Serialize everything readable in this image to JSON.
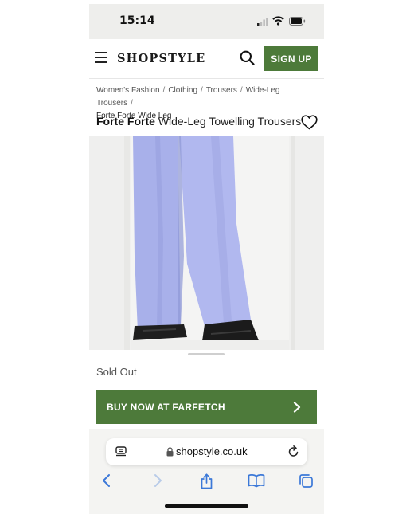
{
  "status_bar": {
    "time": "15:14"
  },
  "header": {
    "logo": "SHOPSTYLE",
    "signup_label": "SIGN UP"
  },
  "breadcrumb": {
    "items": [
      "Women's Fashion",
      "Clothing",
      "Trousers",
      "Wide-Leg Trousers"
    ],
    "separator": "/",
    "current": "Forte Forte Wide Leg"
  },
  "product": {
    "brand": "Forte Forte",
    "name": "Wide-Leg Towelling Trousers",
    "status": "Sold Out",
    "buy_label": "BUY NOW AT FARFETCH"
  },
  "browser": {
    "url": "shopstyle.co.uk"
  },
  "colors": {
    "accent_green": "#4d7a3a",
    "trouser_lilac": "#a6aee8"
  },
  "icons": [
    "menu-icon",
    "search-icon",
    "heart-icon",
    "chevron-right-icon",
    "reader-icon",
    "lock-icon",
    "reload-icon",
    "back-icon",
    "forward-icon",
    "share-icon",
    "bookmarks-icon",
    "tabs-icon"
  ]
}
